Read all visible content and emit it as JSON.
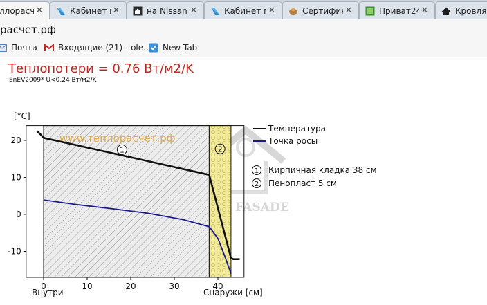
{
  "browser": {
    "tabs": [
      {
        "label": "ллорасчет.рф",
        "icon": "site-icon",
        "active": true
      },
      {
        "label": "Кабинет п",
        "icon": "blue-arrow-icon",
        "active": false
      },
      {
        "label": "на Nissan",
        "icon": "house-icon",
        "active": false
      },
      {
        "label": "Кабинет п",
        "icon": "blue-arrow-icon",
        "active": false
      },
      {
        "label": "Сертифик",
        "icon": "tool-icon",
        "active": false
      },
      {
        "label": "Приват24",
        "icon": "green-square-icon",
        "active": false
      },
      {
        "label": "Кровля и",
        "icon": "roof-icon",
        "active": false
      }
    ],
    "url": "расчет.рф",
    "bookmarks": [
      {
        "label": "Почта",
        "icon": "mail-icon"
      },
      {
        "label": "Входящие (21) - ole...",
        "icon": "gmail-icon"
      },
      {
        "label": "New Tab",
        "icon": "shield-check-icon"
      }
    ]
  },
  "page": {
    "heading": "Теплопотери = 0.76 Вт/м2/K",
    "subheading": "EnEV2009* U<0,24 Вт/м2/K",
    "watermark_text": "www.теплорасчет.рф",
    "logo_text": "ROOF FASADE"
  },
  "colors": {
    "heading": "#c0281e",
    "temperature_line": "#111111",
    "dewpoint_line": "#1a1a8c",
    "brick_fill": "#e9e9e9",
    "foam_fill": "#f1ea9a",
    "watermark": "#e0a030"
  },
  "chart_data": {
    "type": "line",
    "ylabel": "[°C]",
    "x_tick_labels": [
      "0",
      "10",
      "20",
      "30",
      "40"
    ],
    "y_tick_labels": [
      "20",
      "10",
      "0",
      "-10"
    ],
    "x_label_inside": "Внутри",
    "x_label_outside": "Снаружи [см]",
    "xlim": [
      -4,
      46
    ],
    "ylim": [
      -17,
      24
    ],
    "layers": [
      {
        "marker": "1",
        "name": "Кирпичная кладка 38 см",
        "from": 0,
        "to": 38,
        "fill": "brick"
      },
      {
        "marker": "2",
        "name": "Пенопласт 5 см",
        "from": 38,
        "to": 43,
        "fill": "foam"
      }
    ],
    "series": [
      {
        "name": "Температура",
        "color": "#111111",
        "x": [
          -1.5,
          -0.6,
          0,
          38,
          43,
          43.5,
          45
        ],
        "y": [
          22.5,
          21.5,
          20.7,
          10.7,
          -11.8,
          -12.1,
          -12.1
        ]
      },
      {
        "name": "Точка росы",
        "color": "#1a1a8c",
        "x": [
          0,
          8,
          16,
          24,
          32,
          38,
          40,
          41.5,
          43
        ],
        "y": [
          3.9,
          2.6,
          1.5,
          0.3,
          -1.4,
          -3.3,
          -6.5,
          -11,
          -16
        ]
      }
    ]
  }
}
